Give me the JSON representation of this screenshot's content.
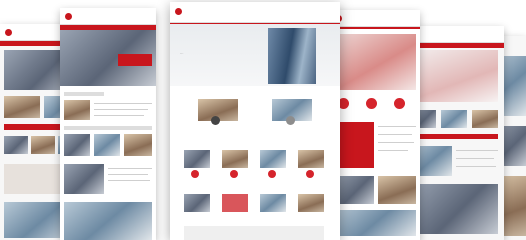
{
  "colors": {
    "brand_red": "#c8161d"
  },
  "center_page": {
    "banner_line3": "…"
  },
  "icons": [
    "logo-mark-icon",
    "service-circle-icon"
  ]
}
